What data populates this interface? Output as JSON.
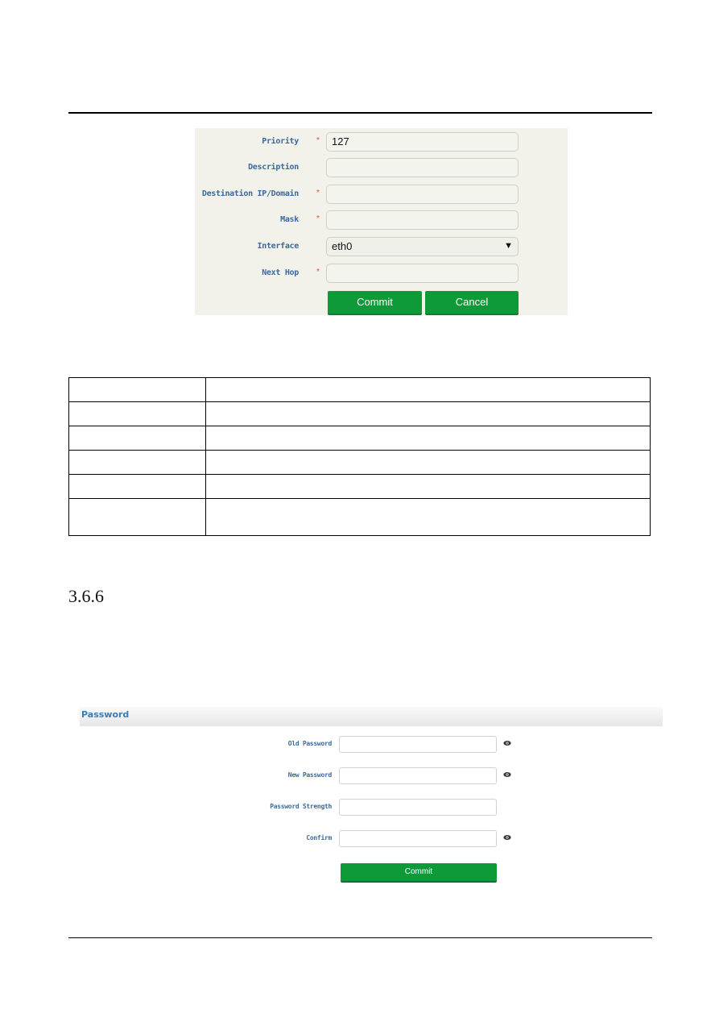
{
  "route_form": {
    "fields": [
      {
        "label": "Priority",
        "required": "*",
        "value": "127"
      },
      {
        "label": "Description",
        "required": "",
        "value": ""
      },
      {
        "label": "Destination IP/Domain",
        "required": "*",
        "value": ""
      },
      {
        "label": "Mask",
        "required": "*",
        "value": ""
      },
      {
        "label": "Interface",
        "required": "",
        "value": "eth0",
        "type": "select",
        "arrow": "▼"
      },
      {
        "label": "Next Hop",
        "required": "*",
        "value": ""
      }
    ],
    "commit_label": "Commit",
    "cancel_label": "Cancel",
    "button_color": "#0f9a3a"
  },
  "param_table": {
    "rows": [
      [
        "",
        ""
      ],
      [
        "",
        ""
      ],
      [
        "",
        ""
      ],
      [
        "",
        ""
      ],
      [
        "",
        ""
      ],
      [
        "",
        ""
      ]
    ]
  },
  "section": {
    "number": "3.6.6"
  },
  "password_panel": {
    "title": "Password",
    "fields": [
      {
        "label": "Old Password",
        "value": "",
        "eye_icon": true
      },
      {
        "label": "New Password",
        "value": "",
        "eye_icon": true
      },
      {
        "label": "Password Strength",
        "value": "",
        "eye_icon": false
      },
      {
        "label": "Confirm",
        "value": "",
        "eye_icon": true
      }
    ],
    "commit_label": "Commit",
    "title_color": "#3b7cb3"
  }
}
